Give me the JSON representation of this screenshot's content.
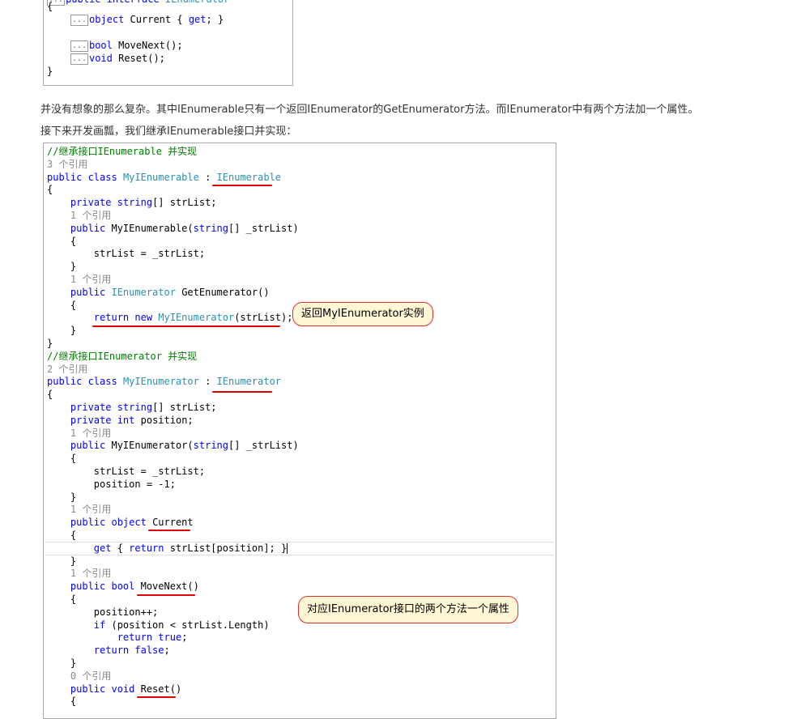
{
  "top_snippet": {
    "lines": [
      {
        "pre": "",
        "dots": true,
        "parts": [
          {
            "t": "public ",
            "c": "kw"
          },
          {
            "t": "interface ",
            "c": "kw"
          },
          {
            "t": "IEnumerator",
            "c": "ty"
          }
        ]
      },
      {
        "pre": "{",
        "dots": false,
        "parts": []
      },
      {
        "pre": "    ",
        "dots": true,
        "parts": [
          {
            "t": "object",
            "c": "kw"
          },
          {
            "t": " Current { ",
            "c": ""
          },
          {
            "t": "get",
            "c": "kw"
          },
          {
            "t": "; }",
            "c": ""
          }
        ]
      },
      {
        "pre": "",
        "dots": false,
        "parts": []
      },
      {
        "pre": "    ",
        "dots": true,
        "parts": [
          {
            "t": "bool",
            "c": "kw"
          },
          {
            "t": " MoveNext();",
            "c": ""
          }
        ]
      },
      {
        "pre": "    ",
        "dots": true,
        "parts": [
          {
            "t": "void",
            "c": "kw"
          },
          {
            "t": " Reset();",
            "c": ""
          }
        ]
      },
      {
        "pre": "}",
        "dots": false,
        "parts": []
      }
    ],
    "dots_label": "..."
  },
  "paragraph1": "并没有想象的那么复杂。其中IEnumerable只有一个返回IEnumerator的GetEnumerator方法。而IEnumerator中有两个方法加一个属性。",
  "paragraph2": "接下来开发画瓢，我们继承IEnumerable接口并实现：",
  "code_lines": [
    [
      {
        "t": "//继承接口IEnumerable 并实现",
        "c": "cm"
      }
    ],
    [
      {
        "t": "3 个引用",
        "c": "ref"
      }
    ],
    [
      {
        "t": "public ",
        "c": "kw"
      },
      {
        "t": "class ",
        "c": "kw"
      },
      {
        "t": "MyIEnumerable",
        "c": "ty"
      },
      {
        "t": " : ",
        "c": ""
      },
      {
        "t": "IEnumerable",
        "c": "ty"
      }
    ],
    [
      {
        "t": "{",
        "c": ""
      }
    ],
    [
      {
        "t": "    private ",
        "c": "kw"
      },
      {
        "t": "string",
        "c": "kw"
      },
      {
        "t": "[] strList;",
        "c": ""
      }
    ],
    [
      {
        "t": "    1 个引用",
        "c": "ref"
      }
    ],
    [
      {
        "t": "    public ",
        "c": "kw"
      },
      {
        "t": "MyIEnumerable(",
        "c": ""
      },
      {
        "t": "string",
        "c": "kw"
      },
      {
        "t": "[] _strList)",
        "c": ""
      }
    ],
    [
      {
        "t": "    {",
        "c": ""
      }
    ],
    [
      {
        "t": "        strList = _strList;",
        "c": ""
      }
    ],
    [
      {
        "t": "    }",
        "c": ""
      }
    ],
    [
      {
        "t": "    1 个引用",
        "c": "ref"
      }
    ],
    [
      {
        "t": "    public ",
        "c": "kw"
      },
      {
        "t": "IEnumerator",
        "c": "ty"
      },
      {
        "t": " GetEnumerator()",
        "c": ""
      }
    ],
    [
      {
        "t": "    {",
        "c": ""
      }
    ],
    [
      {
        "t": "        return ",
        "c": "kw"
      },
      {
        "t": "new ",
        "c": "kw"
      },
      {
        "t": "MyIEnumerator",
        "c": "ty"
      },
      {
        "t": "(strList);",
        "c": ""
      }
    ],
    [
      {
        "t": "    }",
        "c": ""
      }
    ],
    [
      {
        "t": "}",
        "c": ""
      }
    ],
    [
      {
        "t": "//继承接口IEnumerator 并实现",
        "c": "cm"
      }
    ],
    [
      {
        "t": "2 个引用",
        "c": "ref"
      }
    ],
    [
      {
        "t": "public ",
        "c": "kw"
      },
      {
        "t": "class ",
        "c": "kw"
      },
      {
        "t": "MyIEnumerator",
        "c": "ty"
      },
      {
        "t": " : ",
        "c": ""
      },
      {
        "t": "IEnumerator",
        "c": "ty"
      }
    ],
    [
      {
        "t": "{",
        "c": ""
      }
    ],
    [
      {
        "t": "    private ",
        "c": "kw"
      },
      {
        "t": "string",
        "c": "kw"
      },
      {
        "t": "[] strList;",
        "c": ""
      }
    ],
    [
      {
        "t": "    private ",
        "c": "kw"
      },
      {
        "t": "int",
        "c": "kw"
      },
      {
        "t": " position;",
        "c": ""
      }
    ],
    [
      {
        "t": "    1 个引用",
        "c": "ref"
      }
    ],
    [
      {
        "t": "    public ",
        "c": "kw"
      },
      {
        "t": "MyIEnumerator(",
        "c": ""
      },
      {
        "t": "string",
        "c": "kw"
      },
      {
        "t": "[] _strList)",
        "c": ""
      }
    ],
    [
      {
        "t": "    {",
        "c": ""
      }
    ],
    [
      {
        "t": "        strList = _strList;",
        "c": ""
      }
    ],
    [
      {
        "t": "        position = -1;",
        "c": ""
      }
    ],
    [
      {
        "t": "    }",
        "c": ""
      }
    ],
    [
      {
        "t": "    1 个引用",
        "c": "ref"
      }
    ],
    [
      {
        "t": "    public ",
        "c": "kw"
      },
      {
        "t": "object ",
        "c": "kw"
      },
      {
        "t": "Current",
        "c": ""
      }
    ],
    [
      {
        "t": "    {",
        "c": ""
      }
    ],
    [
      {
        "t": "        get ",
        "c": "kw"
      },
      {
        "t": "{ ",
        "c": ""
      },
      {
        "t": "return ",
        "c": "kw"
      },
      {
        "t": "strList[position]; }",
        "c": ""
      }
    ],
    [
      {
        "t": "    }",
        "c": ""
      }
    ],
    [
      {
        "t": "    1 个引用",
        "c": "ref"
      }
    ],
    [
      {
        "t": "    public ",
        "c": "kw"
      },
      {
        "t": "bool ",
        "c": "kw"
      },
      {
        "t": "MoveNext()",
        "c": ""
      }
    ],
    [
      {
        "t": "    {",
        "c": ""
      }
    ],
    [
      {
        "t": "        position++;",
        "c": ""
      }
    ],
    [
      {
        "t": "        if ",
        "c": "kw"
      },
      {
        "t": "(position < strList.Length)",
        "c": ""
      }
    ],
    [
      {
        "t": "            return ",
        "c": "kw"
      },
      {
        "t": "true",
        "c": "kw"
      },
      {
        "t": ";",
        "c": ""
      }
    ],
    [
      {
        "t": "        return ",
        "c": "kw"
      },
      {
        "t": "false",
        "c": "kw"
      },
      {
        "t": ";",
        "c": ""
      }
    ],
    [
      {
        "t": "    }",
        "c": ""
      }
    ],
    [
      {
        "t": "    0 个引用",
        "c": "ref"
      }
    ],
    [
      {
        "t": "    public ",
        "c": "kw"
      },
      {
        "t": "void ",
        "c": "kw"
      },
      {
        "t": "Reset()",
        "c": ""
      }
    ],
    [
      {
        "t": "    {",
        "c": ""
      }
    ]
  ],
  "callout1": "返回MyIEnumerator实例",
  "callout2": "对应IEnumerator接口的两个方法一个属性",
  "colors": {
    "keyword": "#0000ff",
    "type": "#2b91af",
    "comment": "#008000",
    "reference_count": "#8a8a8a",
    "underline": "#e00000",
    "callout_border": "#e03030",
    "callout_fill": "#fff6d6"
  }
}
